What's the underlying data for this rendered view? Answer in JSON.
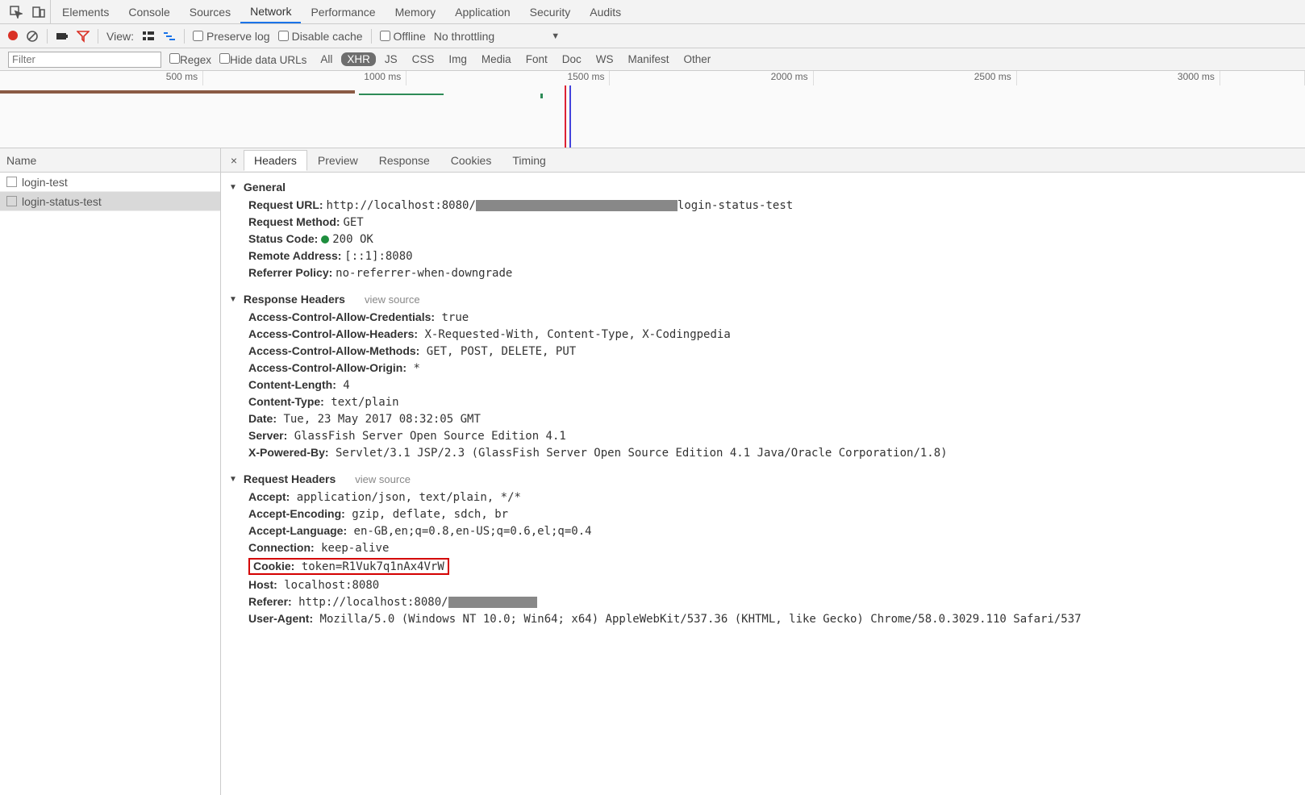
{
  "tabs": {
    "items": [
      "Elements",
      "Console",
      "Sources",
      "Network",
      "Performance",
      "Memory",
      "Application",
      "Security",
      "Audits"
    ],
    "active": "Network"
  },
  "toolbar": {
    "view_label": "View:",
    "preserve_log": "Preserve log",
    "disable_cache": "Disable cache",
    "offline": "Offline",
    "throttling": "No throttling"
  },
  "filterbar": {
    "filter_placeholder": "Filter",
    "regex": "Regex",
    "hide_data_urls": "Hide data URLs",
    "types": [
      "All",
      "XHR",
      "JS",
      "CSS",
      "Img",
      "Media",
      "Font",
      "Doc",
      "WS",
      "Manifest",
      "Other"
    ],
    "active_type": "XHR"
  },
  "timeline": {
    "ticks": [
      "500 ms",
      "1000 ms",
      "1500 ms",
      "2000 ms",
      "2500 ms",
      "3000 ms"
    ]
  },
  "names": {
    "header": "Name",
    "rows": [
      "login-test",
      "login-status-test"
    ],
    "selected": "login-status-test"
  },
  "detail_tabs": {
    "items": [
      "Headers",
      "Preview",
      "Response",
      "Cookies",
      "Timing"
    ],
    "active": "Headers"
  },
  "sections": {
    "general": {
      "title": "General",
      "request_url_label": "Request URL:",
      "request_url_prefix": "http://localhost:8080/",
      "request_url_suffix": "login-status-test",
      "request_method_label": "Request Method:",
      "request_method": "GET",
      "status_code_label": "Status Code:",
      "status_code": "200 OK",
      "remote_address_label": "Remote Address:",
      "remote_address": "[::1]:8080",
      "referrer_policy_label": "Referrer Policy:",
      "referrer_policy": "no-referrer-when-downgrade"
    },
    "response_headers": {
      "title": "Response Headers",
      "view_source": "view source",
      "items": [
        {
          "k": "Access-Control-Allow-Credentials:",
          "v": "true"
        },
        {
          "k": "Access-Control-Allow-Headers:",
          "v": "X-Requested-With, Content-Type, X-Codingpedia"
        },
        {
          "k": "Access-Control-Allow-Methods:",
          "v": "GET, POST, DELETE, PUT"
        },
        {
          "k": "Access-Control-Allow-Origin:",
          "v": "*"
        },
        {
          "k": "Content-Length:",
          "v": "4"
        },
        {
          "k": "Content-Type:",
          "v": "text/plain"
        },
        {
          "k": "Date:",
          "v": "Tue, 23 May 2017 08:32:05 GMT"
        },
        {
          "k": "Server:",
          "v": "GlassFish Server Open Source Edition  4.1"
        },
        {
          "k": "X-Powered-By:",
          "v": "Servlet/3.1 JSP/2.3 (GlassFish Server Open Source Edition  4.1  Java/Oracle Corporation/1.8)"
        }
      ]
    },
    "request_headers": {
      "title": "Request Headers",
      "view_source": "view source",
      "items": [
        {
          "k": "Accept:",
          "v": "application/json, text/plain, */*"
        },
        {
          "k": "Accept-Encoding:",
          "v": "gzip, deflate, sdch, br"
        },
        {
          "k": "Accept-Language:",
          "v": "en-GB,en;q=0.8,en-US;q=0.6,el;q=0.4"
        },
        {
          "k": "Connection:",
          "v": "keep-alive"
        },
        {
          "k": "Cookie:",
          "v": "token=R1Vuk7q1nAx4VrW",
          "highlight": true
        },
        {
          "k": "Host:",
          "v": "localhost:8080"
        },
        {
          "k": "Referer:",
          "v": "http://localhost:8080/",
          "redacted": true
        },
        {
          "k": "User-Agent:",
          "v": "Mozilla/5.0 (Windows NT 10.0; Win64; x64) AppleWebKit/537.36 (KHTML, like Gecko) Chrome/58.0.3029.110 Safari/537"
        }
      ]
    }
  }
}
